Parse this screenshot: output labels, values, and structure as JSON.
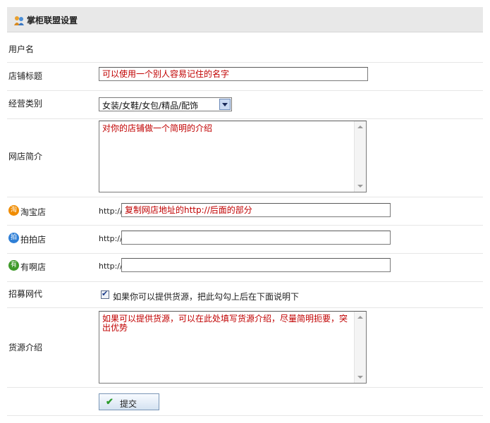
{
  "header": {
    "title": "掌柜联盟设置",
    "icon": "users-icon"
  },
  "form": {
    "username": {
      "label": "用户名"
    },
    "shop_title": {
      "label": "店铺标题",
      "value": "可以使用一个别人容易记住的名字"
    },
    "category": {
      "label": "经营类别",
      "selected": "女装/女鞋/女包/精品/配饰"
    },
    "intro": {
      "label": "网店简介",
      "value": "对你的店铺做一个简明的介绍"
    },
    "taobao": {
      "label": "淘宝店",
      "icon_char": "淘",
      "prefix": "http://",
      "value": "复制网店地址的http://后面的部分"
    },
    "paipai": {
      "label": "拍拍店",
      "icon_char": "拍",
      "prefix": "http://",
      "value": ""
    },
    "youa": {
      "label": "有啊店",
      "icon_char": "有",
      "prefix": "http://",
      "value": ""
    },
    "recruit": {
      "label": "招募网代",
      "checkbox_label": "如果你可以提供货源，把此勾勾上后在下面说明下",
      "checked": true
    },
    "supply": {
      "label": "货源介绍",
      "value": "如果可以提供货源，可以在此处填写货源介绍，尽量简明扼要，突出优势"
    },
    "submit_label": "提交"
  },
  "colors": {
    "hint_text": "#c00000",
    "taobao": "#f08c00",
    "paipai": "#2f7fd6",
    "youa": "#3f9a2a"
  }
}
